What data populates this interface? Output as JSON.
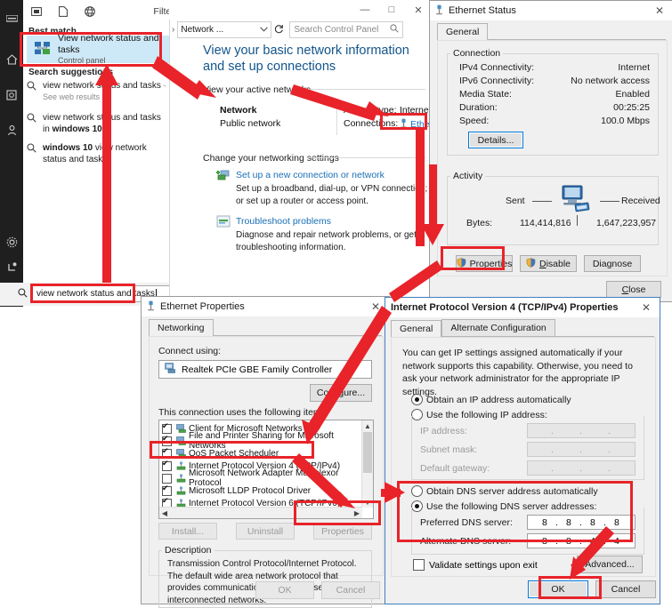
{
  "start_menu": {
    "top_icons": [
      "hamburger-icon",
      "apps-icon",
      "document-icon",
      "web-icon"
    ],
    "filters_label": "Filters",
    "rail_icons": [
      "hamburger-icon",
      "home-icon",
      "documents-icon",
      "person-icon",
      "settings-icon",
      "power-icon",
      "windows-logo-icon"
    ],
    "best_match_label": "Best match",
    "best_match": {
      "title": "View network status and tasks",
      "subtitle": "Control panel"
    },
    "suggestions_label": "Search suggestions",
    "suggestions": [
      {
        "main": "view network status and tasks",
        "suffix": " - See web results",
        "bold_prefix": ""
      },
      {
        "main": "view network status and tasks in ",
        "bold_tail": "windows 10"
      },
      {
        "bold_prefix": "windows 10",
        "main": " view network status and tasks"
      }
    ],
    "taskbar_search_value": "view network status and tasks"
  },
  "control_panel": {
    "window_buttons": [
      "minimize",
      "maximize",
      "close"
    ],
    "breadcrumb": "Network ...",
    "refresh_icon": "refresh-icon",
    "search_placeholder": "Search Control Panel",
    "heading": "View your basic network information and set up connections",
    "active_networks_label": "View your active networks",
    "network": {
      "name": "Network",
      "type": "Public network",
      "access_type_label": "Access type:",
      "access_type_value": "Internet",
      "connections_label": "Connections:",
      "connections_value": "Ethernet"
    },
    "change_settings_label": "Change your networking settings",
    "tasks": [
      {
        "link": "Set up a new connection or network",
        "desc": "Set up a broadband, dial-up, or VPN connection; or set up a router or access point."
      },
      {
        "link": "Troubleshoot problems",
        "desc": "Diagnose and repair network problems, or get troubleshooting information."
      }
    ]
  },
  "ethernet_status": {
    "title": "Ethernet Status",
    "tabs": [
      "General"
    ],
    "connection_group_label": "Connection",
    "rows": [
      {
        "label": "IPv4 Connectivity:",
        "value": "Internet"
      },
      {
        "label": "IPv6 Connectivity:",
        "value": "No network access"
      },
      {
        "label": "Media State:",
        "value": "Enabled"
      },
      {
        "label": "Duration:",
        "value": "00:25:25"
      },
      {
        "label": "Speed:",
        "value": "100.0 Mbps"
      }
    ],
    "details_button": "Details...",
    "activity_group_label": "Activity",
    "sent_label": "Sent",
    "received_label": "Received",
    "bytes_label": "Bytes:",
    "bytes_sent": "114,414,816",
    "bytes_received": "1,647,223,957",
    "buttons": {
      "properties": "Properties",
      "disable": "Disable",
      "diagnose": "Diagnose",
      "close": "Close"
    }
  },
  "ethernet_properties": {
    "title": "Ethernet Properties",
    "tabs": [
      "Networking"
    ],
    "connect_using_label": "Connect using:",
    "adapter": "Realtek PCIe GBE Family Controller",
    "configure_button": "Configure...",
    "items_label": "This connection uses the following items:",
    "items": [
      {
        "label": "Client for Microsoft Networks",
        "checked": true
      },
      {
        "label": "File and Printer Sharing for Microsoft Networks",
        "checked": true
      },
      {
        "label": "QoS Packet Scheduler",
        "checked": true
      },
      {
        "label": "Internet Protocol Version 4 (TCP/IPv4)",
        "checked": true
      },
      {
        "label": "Microsoft Network Adapter Multiplexor Protocol",
        "checked": false
      },
      {
        "label": "Microsoft LLDP Protocol Driver",
        "checked": true
      },
      {
        "label": "Internet Protocol Version 6 (TCP/IPv6)",
        "checked": true
      }
    ],
    "buttons": {
      "install": "Install...",
      "uninstall": "Uninstall",
      "properties": "Properties",
      "ok": "OK",
      "cancel": "Cancel"
    },
    "description_label": "Description",
    "description_text": "Transmission Control Protocol/Internet Protocol. The default wide area network protocol that provides communication across diverse interconnected networks."
  },
  "ipv4_properties": {
    "title": "Internet Protocol Version 4 (TCP/IPv4) Properties",
    "tabs": [
      "General",
      "Alternate Configuration"
    ],
    "intro": "You can get IP settings assigned automatically if your network supports this capability. Otherwise, you need to ask your network administrator for the appropriate IP settings.",
    "radio_obtain_ip": "Obtain an IP address automatically",
    "radio_use_ip": "Use the following IP address:",
    "ip_labels": {
      "ip": "IP address:",
      "subnet": "Subnet mask:",
      "gateway": "Default gateway:"
    },
    "radio_obtain_dns": "Obtain DNS server address automatically",
    "radio_use_dns": "Use the following DNS server addresses:",
    "dns_labels": {
      "preferred": "Preferred DNS server:",
      "alternate": "Alternate DNS server:"
    },
    "dns_values": {
      "preferred": [
        "8",
        "8",
        "8",
        "8"
      ],
      "alternate": [
        "8",
        "8",
        "4",
        "4"
      ]
    },
    "empty_octets": [
      "",
      "",
      "",
      ""
    ],
    "validate_checkbox": "Validate settings upon exit",
    "advanced_button": "Advanced...",
    "buttons": {
      "ok": "OK",
      "cancel": "Cancel"
    }
  },
  "annotation": {
    "color": "#e8232a"
  }
}
